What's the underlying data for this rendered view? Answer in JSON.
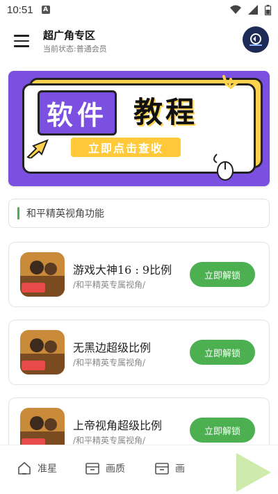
{
  "statusbar": {
    "time": "10:51"
  },
  "header": {
    "title": "超广角专区",
    "subtitle": "当前状态:普通会员"
  },
  "banner": {
    "tag_left": "软件",
    "tag_right": "教程",
    "cta": "立即点击查收"
  },
  "section": {
    "label": "和平精英视角功能"
  },
  "items": [
    {
      "name": "游戏大神16 : 9比例",
      "desc": "/和平精英专属视角/",
      "button": "立即解锁"
    },
    {
      "name": "无黑边超级比例",
      "desc": "/和平精英专属视角/",
      "button": "立即解锁"
    },
    {
      "name": "上帝视角超级比例",
      "desc": "/和平精英专属视角/",
      "button": "立即解锁"
    }
  ],
  "nav": [
    {
      "label": "准星",
      "icon": "home-icon"
    },
    {
      "label": "画质",
      "icon": "box-icon"
    },
    {
      "label": "画",
      "icon": "box-icon"
    }
  ],
  "colors": {
    "accent": "#4caf50",
    "banner": "#7b4fe0",
    "banner_yellow": "#ffd24d"
  }
}
